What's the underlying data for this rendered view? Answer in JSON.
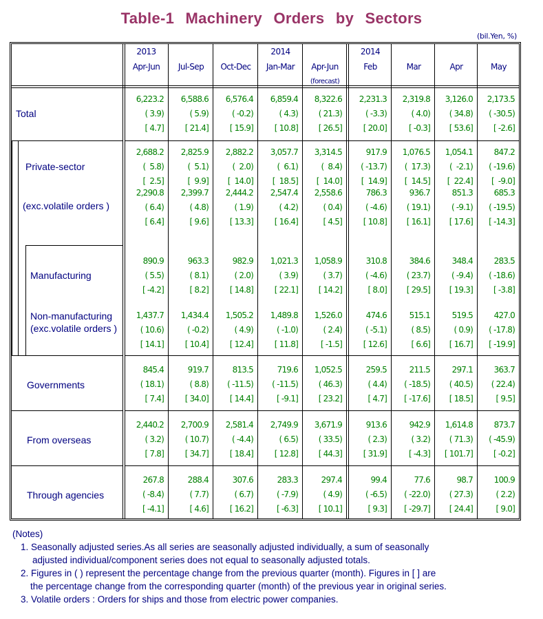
{
  "title": "Table-1   Machinery   Orders   by   Sectors",
  "unit": "(bil.Yen, %)",
  "columns": [
    {
      "line1": "2013",
      "line2": "Apr-Jun",
      "line3": ""
    },
    {
      "line1": "",
      "line2": "Jul-Sep",
      "line3": ""
    },
    {
      "line1": "",
      "line2": "Oct-Dec",
      "line3": ""
    },
    {
      "line1": "2014",
      "line2": "Jan-Mar",
      "line3": ""
    },
    {
      "line1": "",
      "line2": "Apr-Jun",
      "line3": "(forecast)"
    },
    {
      "line1": "2014",
      "line2": "Feb",
      "line3": ""
    },
    {
      "line1": "",
      "line2": "Mar",
      "line3": ""
    },
    {
      "line1": "",
      "line2": "Apr",
      "line3": ""
    },
    {
      "line1": "",
      "line2": "May",
      "line3": ""
    }
  ],
  "rows": [
    {
      "label": "Total",
      "label2": "",
      "values": [
        "6,223.2",
        "6,588.6",
        "6,576.4",
        "6,859.4",
        "8,322.6",
        "2,231.3",
        "2,319.8",
        "3,126.0",
        "2,173.5"
      ],
      "qoq": [
        "( 3.9)",
        "( 5.9)",
        "( -0.2)",
        "( 4.3)",
        "( 21.3)",
        "( -3.3)",
        "( 4.0)",
        "( 34.8)",
        "( -30.5)"
      ],
      "yoy": [
        "[ 4.7]",
        "[ 21.4]",
        "[ 15.9]",
        "[ 10.8]",
        "[ 26.5]",
        "[ 20.0]",
        "[ -0.3]",
        "[ 53.6]",
        "[ -2.6]"
      ]
    },
    {
      "label": "Private-sector",
      "label2": "",
      "values": [
        "2,688.2",
        "2,825.9",
        "2,882.2",
        "3,057.7",
        "3,314.5",
        "917.9",
        "1,076.5",
        "1,054.1",
        "847.2"
      ],
      "qoq": [
        "(  5.8)",
        "(  5.1)",
        "(  2.0)",
        "(  6.1)",
        "(  8.4)",
        "( -13.7)",
        "(  17.3)",
        "(  -2.1)",
        "( -19.6)"
      ],
      "yoy": [
        "[  2.5]",
        "[  9.9]",
        "[  14.0]",
        "[  18.5]",
        "[  14.0]",
        "[  14.9]",
        "[  14.5]",
        "[  22.4]",
        "[  -9.0]"
      ]
    },
    {
      "label": "(exc.volatile orders )",
      "label2": "",
      "values": [
        "2,290.8",
        "2,399.7",
        "2,444.2",
        "2,547.4",
        "2,558.6",
        "786.3",
        "936.7",
        "851.3",
        "685.3"
      ],
      "qoq": [
        "( 6.4)",
        "( 4.8)",
        "( 1.9)",
        "( 4.2)",
        "( 0.4)",
        "( -4.6)",
        "( 19.1)",
        "( -9.1)",
        "( -19.5)"
      ],
      "yoy": [
        "[ 6.4]",
        "[ 9.6]",
        "[ 13.3]",
        "[ 16.4]",
        "[ 4.5]",
        "[ 10.8]",
        "[ 16.1]",
        "[ 17.6]",
        "[ -14.3]"
      ]
    },
    {
      "label": "Manufacturing",
      "label2": "",
      "values": [
        "890.9",
        "963.3",
        "982.9",
        "1,021.3",
        "1,058.9",
        "310.8",
        "384.6",
        "348.4",
        "283.5"
      ],
      "qoq": [
        "( 5.5)",
        "( 8.1)",
        "( 2.0)",
        "( 3.9)",
        "( 3.7)",
        "( -4.6)",
        "( 23.7)",
        "( -9.4)",
        "( -18.6)"
      ],
      "yoy": [
        "[ -4.2]",
        "[ 8.2]",
        "[ 14.8]",
        "[ 22.1]",
        "[ 14.2]",
        "[ 8.0]",
        "[ 29.5]",
        "[ 19.3]",
        "[ -3.8]"
      ]
    },
    {
      "label": "Non-manufacturing",
      "label2": "(exc.volatile orders )",
      "values": [
        "1,437.7",
        "1,434.4",
        "1,505.2",
        "1,489.8",
        "1,526.0",
        "474.6",
        "515.1",
        "519.5",
        "427.0"
      ],
      "qoq": [
        "( 10.6)",
        "( -0.2)",
        "( 4.9)",
        "( -1.0)",
        "( 2.4)",
        "( -5.1)",
        "( 8.5)",
        "( 0.9)",
        "( -17.8)"
      ],
      "yoy": [
        "[ 14.1]",
        "[ 10.4]",
        "[ 12.4]",
        "[ 11.8]",
        "[ -1.5]",
        "[ 12.6]",
        "[ 6.6]",
        "[ 16.7]",
        "[ -19.9]"
      ]
    },
    {
      "label": "Governments",
      "label2": "",
      "values": [
        "845.4",
        "919.7",
        "813.5",
        "719.6",
        "1,052.5",
        "259.5",
        "211.5",
        "297.1",
        "363.7"
      ],
      "qoq": [
        "( 18.1)",
        "( 8.8)",
        "( -11.5)",
        "( -11.5)",
        "( 46.3)",
        "( 4.4)",
        "( -18.5)",
        "( 40.5)",
        "( 22.4)"
      ],
      "yoy": [
        "[ 7.4]",
        "[ 34.0]",
        "[ 14.4]",
        "[ -9.1]",
        "[ 23.2]",
        "[ 4.7]",
        "[ -17.6]",
        "[ 18.5]",
        "[ 9.5]"
      ]
    },
    {
      "label": "From overseas",
      "label2": "",
      "values": [
        "2,440.2",
        "2,700.9",
        "2,581.4",
        "2,749.9",
        "3,671.9",
        "913.6",
        "942.9",
        "1,614.8",
        "873.7"
      ],
      "qoq": [
        "( 3.2)",
        "( 10.7)",
        "( -4.4)",
        "( 6.5)",
        "( 33.5)",
        "( 2.3)",
        "( 3.2)",
        "( 71.3)",
        "( -45.9)"
      ],
      "yoy": [
        "[ 7.8]",
        "[ 34.7]",
        "[ 18.4]",
        "[ 12.8]",
        "[ 44.3]",
        "[ 31.9]",
        "[ -4.3]",
        "[ 101.7]",
        "[ -0.2]"
      ]
    },
    {
      "label": "Through agencies",
      "label2": "",
      "values": [
        "267.8",
        "288.4",
        "307.6",
        "283.3",
        "297.4",
        "99.4",
        "77.6",
        "98.7",
        "100.9"
      ],
      "qoq": [
        "( -8.4)",
        "( 7.7)",
        "( 6.7)",
        "( -7.9)",
        "( 4.9)",
        "( -6.5)",
        "( -22.0)",
        "( 27.3)",
        "( 2.2)"
      ],
      "yoy": [
        "[ -4.1]",
        "[ 4.6]",
        "[ 16.2]",
        "[ -6.3]",
        "[ 10.1]",
        "[ 9.3]",
        "[ -29.7]",
        "[ 24.4]",
        "[ 9.0]"
      ]
    }
  ],
  "notes": {
    "heading": "(Notes)",
    "items": [
      {
        "line1": "1. Seasonally adjusted series.As all series are seasonally adjusted individually, a sum of seasonally",
        "line2": "adjusted individual/component series does not equal to seasonally adjusted totals."
      },
      {
        "line1": "2. Figures in ( ) represent the percentage change from the previous quarter (month). Figures in [ ] are",
        "line2": "the percentage change from the corresponding quarter (month) of the previous year in original series."
      },
      {
        "line1": "3. Volatile orders : Orders for ships and those from electric power companies.",
        "line2": ""
      }
    ]
  },
  "colors": {
    "title": "#993366",
    "labels": "#000080",
    "values": "#008000",
    "lines": "#000000"
  }
}
